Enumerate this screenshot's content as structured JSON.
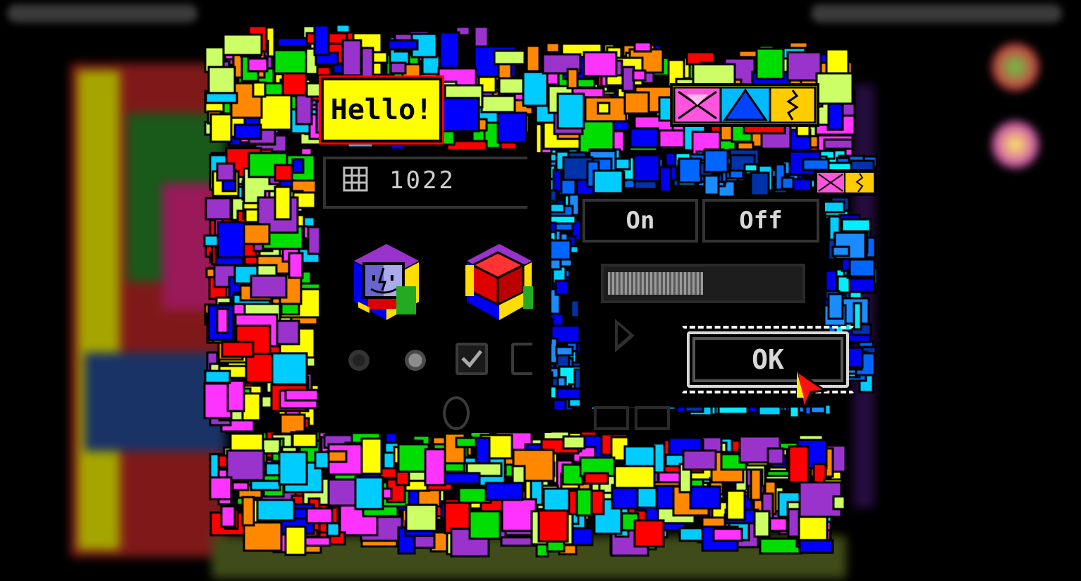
{
  "main_window": {
    "banner_text": "Hello!",
    "counter": {
      "icon": "grid-icon",
      "value": "1022"
    },
    "cubes": [
      {
        "icon": "finder-face-cube-icon"
      },
      {
        "icon": "red-block-cube-icon"
      }
    ],
    "controls": {
      "radio_unselected": "radio-off",
      "radio_selected": "radio-on",
      "checkbox_checked": true
    }
  },
  "sub_window": {
    "segments": [
      {
        "label": "On"
      },
      {
        "label": "Off"
      }
    ],
    "progress": 0.5,
    "ok_label": "OK"
  },
  "title_widgets": {
    "main": [
      "close-icon",
      "zoom-icon",
      "collapse-icon"
    ],
    "sub": [
      "close-icon",
      "collapse-icon"
    ]
  },
  "palette": {
    "yellow": "#ffff00",
    "red": "#ff0000",
    "blue": "#0000ff",
    "green": "#00dd00",
    "purple": "#9933cc",
    "magenta": "#ff33ff",
    "cyan": "#00ccff",
    "orange": "#ff8800",
    "lime": "#ccff66"
  }
}
